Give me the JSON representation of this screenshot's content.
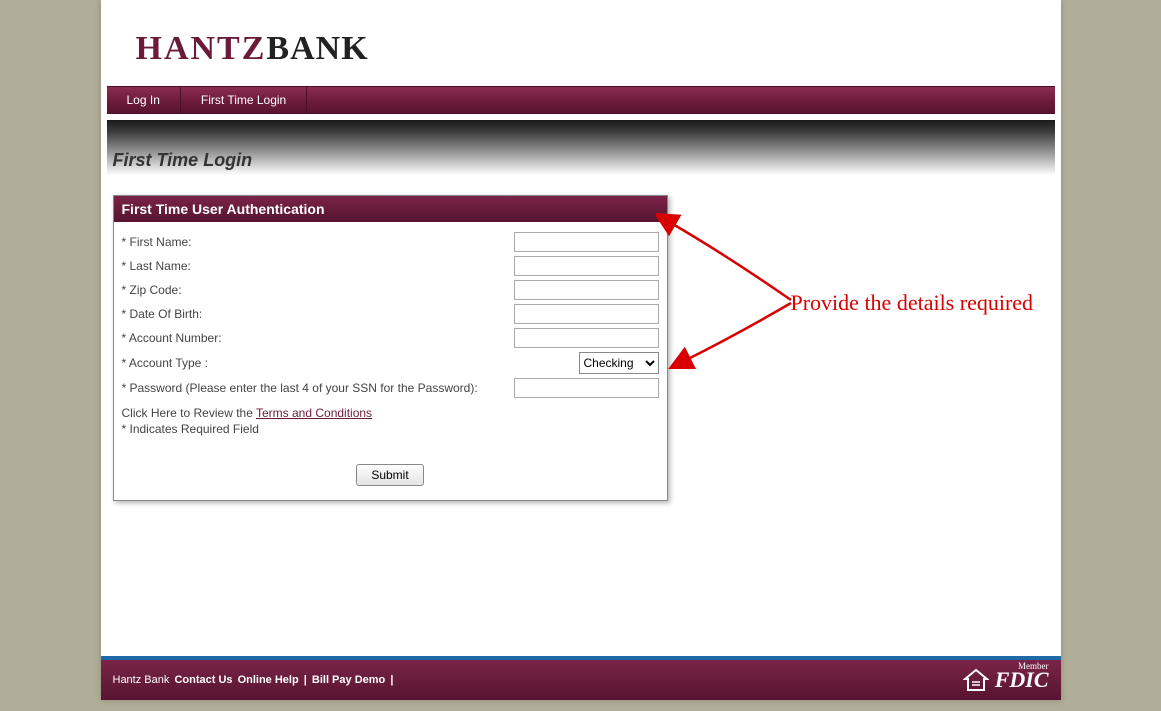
{
  "logo": {
    "part1": "HANTZ",
    "part2": "BANK"
  },
  "nav": {
    "login": "Log In",
    "first_time": "First Time Login"
  },
  "page_title": "First Time Login",
  "form": {
    "header": "First Time User Authentication",
    "fields": {
      "first_name": "* First Name:",
      "last_name": "* Last Name:",
      "zip": "* Zip Code:",
      "dob": "* Date Of Birth:",
      "account_num": "* Account Number:",
      "account_type": "* Account Type :",
      "password": "* Password (Please enter the last 4 of your SSN for the Password):"
    },
    "account_type_value": "Checking",
    "terms_prefix": "Click Here to Review the ",
    "terms_link": "Terms and Conditions",
    "required_note": "* Indicates Required Field",
    "submit": "Submit"
  },
  "annotation": "Provide the details required",
  "footer": {
    "brand": "Hantz Bank",
    "contact": "Contact Us",
    "help": "Online Help",
    "sep": " | ",
    "demo": "Bill Pay Demo",
    "member": "Member",
    "fdic": "FDIC"
  }
}
